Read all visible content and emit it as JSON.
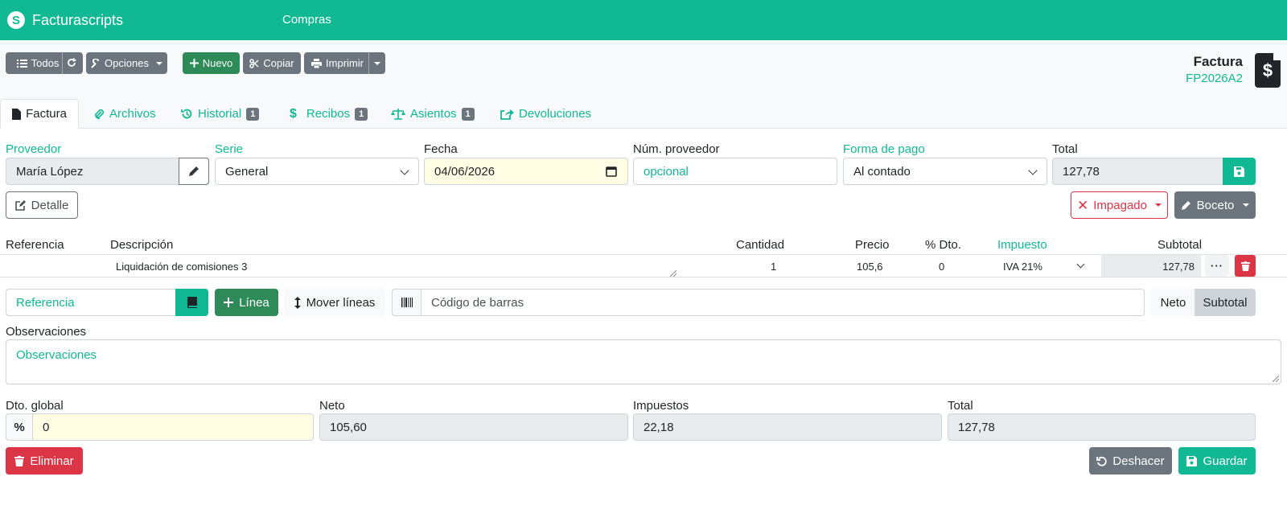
{
  "navbar": {
    "brand": "Facturascripts",
    "logo_letter": "S",
    "menu_item": "Compras"
  },
  "toolbar": {
    "todos_label": "Todos",
    "opciones_label": "Opciones",
    "nuevo_label": "Nuevo",
    "copiar_label": "Copiar",
    "imprimir_label": "Imprimir"
  },
  "document": {
    "type": "Factura",
    "code": "FP2026A2"
  },
  "tabs": [
    {
      "label": "Factura"
    },
    {
      "label": "Archivos"
    },
    {
      "label": "Historial",
      "badge": "1"
    },
    {
      "label": "Recibos",
      "badge": "1"
    },
    {
      "label": "Asientos",
      "badge": "1"
    },
    {
      "label": "Devoluciones"
    }
  ],
  "header_form": {
    "proveedor_label": "Proveedor",
    "proveedor_value": "María López",
    "serie_label": "Serie",
    "serie_value": "General",
    "fecha_label": "Fecha",
    "fecha_value": "04/06/2026",
    "num_proveedor_label": "Núm. proveedor",
    "num_proveedor_placeholder": "opcional",
    "forma_pago_label": "Forma de pago",
    "forma_pago_value": "Al contado",
    "total_label": "Total",
    "total_value": "127,78"
  },
  "actions": {
    "detalle_label": "Detalle",
    "impagado_label": "Impagado",
    "boceto_label": "Boceto"
  },
  "lines": {
    "headers": {
      "referencia": "Referencia",
      "descripcion": "Descripción",
      "cantidad": "Cantidad",
      "precio": "Precio",
      "dto": "% Dto.",
      "impuesto": "Impuesto",
      "subtotal": "Subtotal"
    },
    "rows": [
      {
        "referencia": "",
        "descripcion": "Liquidación de comisiones 3",
        "cantidad": "1",
        "precio": "105,6",
        "dto": "0",
        "impuesto": "IVA 21%",
        "subtotal": "127,78"
      }
    ]
  },
  "add_line": {
    "referencia_placeholder": "Referencia",
    "linea_label": "Línea",
    "mover_label": "Mover líneas",
    "barcode_placeholder": "Código de barras",
    "neto_label": "Neto",
    "subtotal_label": "Subtotal"
  },
  "observaciones": {
    "label": "Observaciones",
    "placeholder": "Observaciones"
  },
  "totals": {
    "dto_global_label": "Dto. global",
    "dto_global_value": "0",
    "neto_label": "Neto",
    "neto_value": "105,60",
    "impuestos_label": "Impuestos",
    "impuestos_value": "22,18",
    "total_label": "Total",
    "total_value": "127,78"
  },
  "footer": {
    "eliminar_label": "Eliminar",
    "deshacer_label": "Deshacer",
    "guardar_label": "Guardar"
  },
  "colors": {
    "brand": "#10b994",
    "success": "#2e8b57",
    "danger": "#dc3545",
    "secondary": "#6c757d",
    "date_highlight": "#fffde3"
  }
}
